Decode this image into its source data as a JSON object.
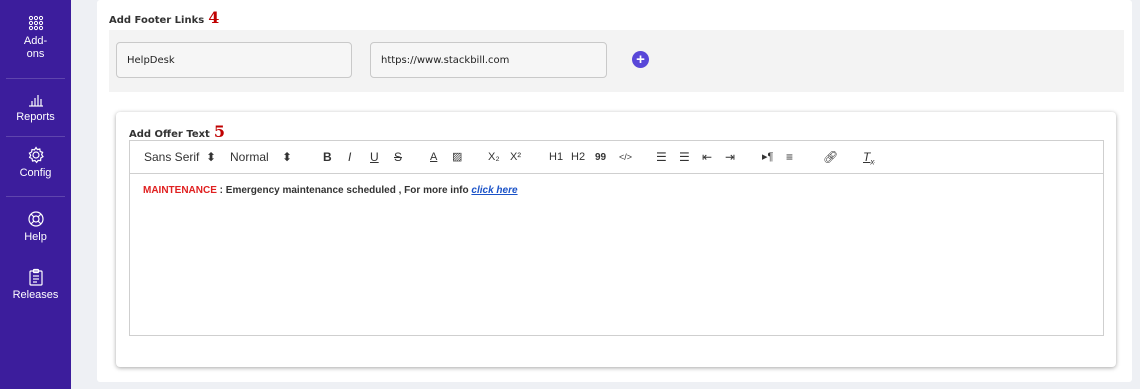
{
  "sidebar": {
    "items": [
      {
        "label": "Add-\nons",
        "icon": "grid-icon"
      },
      {
        "label": "Reports",
        "icon": "bar-chart-icon"
      },
      {
        "label": "Config",
        "icon": "gear-icon"
      },
      {
        "label": "Help",
        "icon": "lifebuoy-icon"
      },
      {
        "label": "Releases",
        "icon": "clipboard-icon"
      }
    ],
    "addons_line1": "Add-",
    "addons_line2": "ons"
  },
  "footer_links": {
    "title": "Add Footer Links",
    "step": "4",
    "name_value": "HelpDesk",
    "url_value": "https://www.stackbill.com"
  },
  "offer_text": {
    "title": "Add Offer Text",
    "step": "5",
    "toolbar": {
      "font": "Sans Serif",
      "size": "Normal",
      "bold": "B",
      "italic": "I",
      "underline": "U",
      "strike": "S",
      "color": "A",
      "sub": "X₂",
      "sup": "X²",
      "h1": "H1",
      "h2": "H2",
      "quote": "99",
      "code": "</>"
    },
    "content": {
      "prefix": "MAINTENANCE",
      "sep": " : ",
      "message": "Emergency maintenance scheduled , For more info ",
      "link": "click here"
    }
  },
  "colors": {
    "sidebar": "#3c1d9c",
    "accent": "#5847d8",
    "maintenance": "#e02020",
    "link": "#1a52c8",
    "step_number": "#c00000"
  }
}
